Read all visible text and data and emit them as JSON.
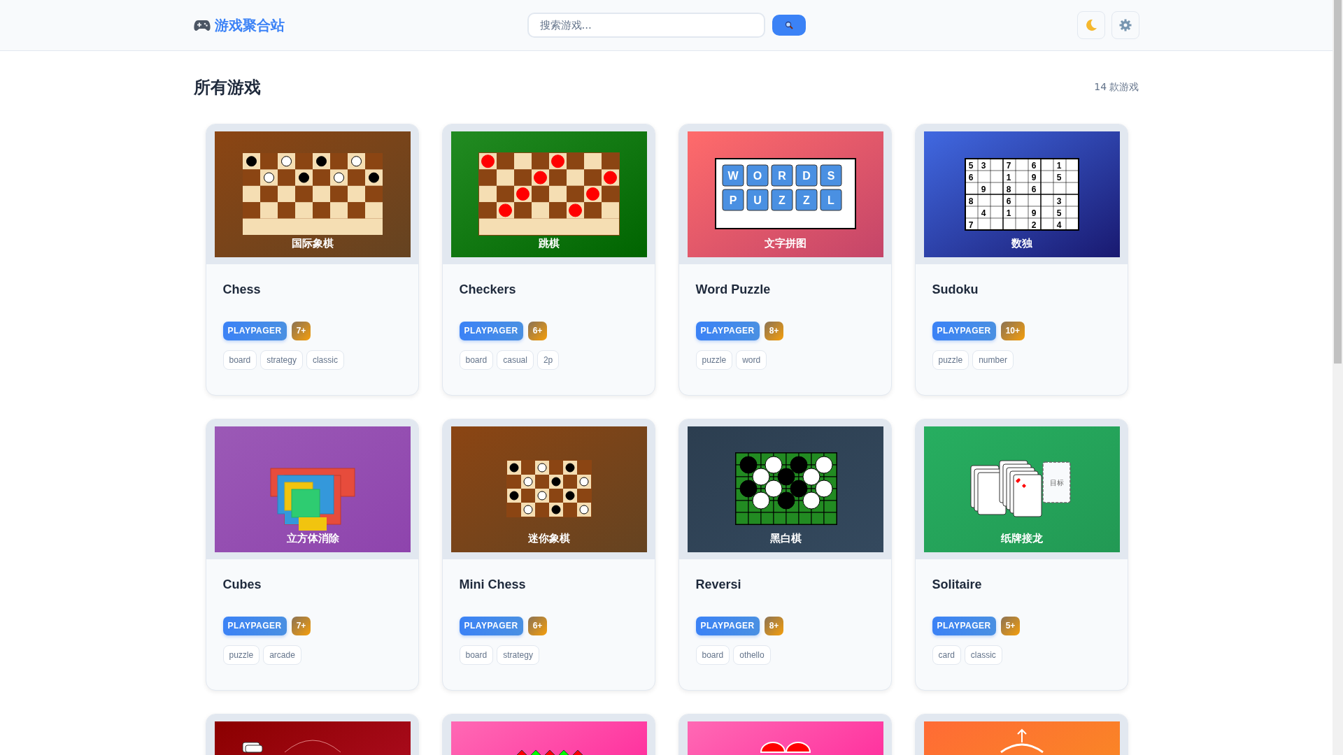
{
  "header": {
    "logo": "游戏聚合站",
    "search": {
      "placeholder": "搜索游戏..."
    }
  },
  "section": {
    "title": "所有游戏",
    "count": "14 款游戏"
  },
  "games": [
    {
      "title": "Chess",
      "source": "PLAYPAGER",
      "age": "7+",
      "tags": [
        "board",
        "strategy",
        "classic"
      ],
      "thumbnail": {
        "kind": "chess",
        "caption": "国际象棋"
      }
    },
    {
      "title": "Checkers",
      "source": "PLAYPAGER",
      "age": "6+",
      "tags": [
        "board",
        "casual",
        "2p"
      ],
      "thumbnail": {
        "kind": "checkers",
        "caption": "跳棋"
      }
    },
    {
      "title": "Word Puzzle",
      "source": "PLAYPAGER",
      "age": "8+",
      "tags": [
        "puzzle",
        "word"
      ],
      "thumbnail": {
        "kind": "words",
        "caption": "文字拼图",
        "tiles": [
          [
            "W",
            "O",
            "R",
            "D",
            "S"
          ],
          [
            "P",
            "U",
            "Z",
            "Z",
            "L"
          ]
        ]
      }
    },
    {
      "title": "Sudoku",
      "source": "PLAYPAGER",
      "age": "10+",
      "tags": [
        "puzzle",
        "number"
      ],
      "thumbnail": {
        "kind": "sudoku",
        "caption": "数独",
        "cells": [
          [
            "5",
            "3",
            null,
            "7",
            null,
            "6",
            null,
            "1",
            null
          ],
          [
            "6",
            null,
            null,
            "1",
            null,
            "9",
            null,
            "5",
            null
          ],
          [
            null,
            "9",
            null,
            "8",
            null,
            "6",
            null,
            null,
            null
          ],
          [
            "8",
            null,
            null,
            "6",
            null,
            null,
            null,
            "3",
            null
          ],
          [
            null,
            "4",
            null,
            "1",
            null,
            "9",
            null,
            "5",
            null
          ],
          [
            "7",
            null,
            null,
            null,
            null,
            "2",
            null,
            "4",
            null
          ]
        ]
      }
    },
    {
      "title": "Cubes",
      "source": "PLAYPAGER",
      "age": "7+",
      "tags": [
        "puzzle",
        "arcade"
      ],
      "thumbnail": {
        "kind": "cubes",
        "caption": "立方体消除"
      }
    },
    {
      "title": "Mini Chess",
      "source": "PLAYPAGER",
      "age": "6+",
      "tags": [
        "board",
        "strategy"
      ],
      "thumbnail": {
        "kind": "mini-chess",
        "caption": "迷你象棋"
      }
    },
    {
      "title": "Reversi",
      "source": "PLAYPAGER",
      "age": "8+",
      "tags": [
        "board",
        "othello"
      ],
      "thumbnail": {
        "kind": "reversi",
        "caption": "黑白棋"
      }
    },
    {
      "title": "Solitaire",
      "source": "PLAYPAGER",
      "age": "5+",
      "tags": [
        "card",
        "classic"
      ],
      "thumbnail": {
        "kind": "solitaire",
        "caption": "纸牌接龙",
        "target": "目标"
      }
    },
    {
      "thumbnail": {
        "kind": "card-table"
      }
    },
    {
      "thumbnail": {
        "kind": "gems"
      }
    },
    {
      "thumbnail": {
        "kind": "hearts"
      }
    },
    {
      "thumbnail": {
        "kind": "wheel"
      }
    }
  ]
}
